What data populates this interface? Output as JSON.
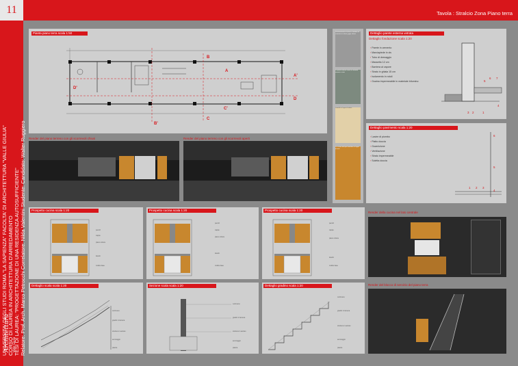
{
  "page_number": "11",
  "header": {
    "title": "Tavola : Stralcio Zona Piano terra"
  },
  "sidebar": {
    "line1": "UNIVERSITA' DEGLI STUDI ROMA \"LA SAPIENZA\" FACOLTA' DI ARCHITETTURA \"VALLE GIULIA\"",
    "line2": "CORSO DI LAUREA IN ARCHITETTURA D'ARREDAMENTO",
    "line3": "TESI DI LAUREA: \"PROGETTAZIONE DI UNA RESIDENZA AUTOSUFFICIENTE\"",
    "line4": "Relatore: Prof. Arch. Marco Petrocchi  Correlatore: Nilda Valentini  Studente: Candidato: Walter Ruggiero"
  },
  "logo": {
    "name": "sapienza-valle-giulia-logo"
  },
  "plan": {
    "caption": "Pianta piano terra   scala 1:50",
    "labels": [
      "A",
      "A'",
      "B",
      "B'",
      "C",
      "C'",
      "D",
      "D'"
    ]
  },
  "materials": {
    "caption": "Dettaglio parete esterna vetrata",
    "samples": [
      "Pavimentazione interna in battuto di cemento in colore grigio chiaro",
      "Le pareti esterne sono in cemento armato a vista",
      "Lamelle in legno di abete",
      "Le cucine del tipo lamellare in legno di teak"
    ]
  },
  "wall_detail": {
    "caption": "Dettaglio fondazione   scala 1:20",
    "items": [
      "Parete in cemento",
      "Marciapiede in cls",
      "Tubo di drenaggio",
      "Massetto 12 cm",
      "Barriera al vapore",
      "Strato in ghiaia 15 cm",
      "Isolamento in rotoli",
      "Guaina impermeabile in materiale bitumino"
    ],
    "numbers": [
      "3",
      "2",
      "1",
      "4",
      "5",
      "6",
      "7"
    ]
  },
  "floor_detail": {
    "caption": "Dettaglio pavimento   scala 1:20",
    "items": [
      "Lastre di piombo",
      "Piatto doccia",
      "Guarnizione",
      "Ventilazione",
      "Strato impermeabile",
      "Soletta doccia"
    ],
    "numbers": [
      "1",
      "2",
      "3",
      "4",
      "5",
      "6"
    ]
  },
  "renders_top": {
    "closed": "Render del piano terreno con gli scorrevoli chiusi",
    "open": "Render del piano terreno con gli scorrevoli aperti"
  },
  "kitchens": [
    {
      "caption": "Prospetto cucina   scala 1:20"
    },
    {
      "caption": "Prospetto cucina   scala 1:20"
    },
    {
      "caption": "Prospetto cucina   scala 1:20"
    }
  ],
  "kitchen_notes": [
    "pensili",
    "cappa",
    "piano cottura",
    "lavello",
    "mobile base"
  ],
  "kitchen_render": "Render della cucina nel lato centrale",
  "stairs": [
    {
      "caption": "Dettaglio scala   scala 1:20"
    },
    {
      "caption": "Sezione scala   scala 1:20"
    },
    {
      "caption": "Dettaglio gradino   scala 1:20"
    }
  ],
  "stair_notes": [
    "corrimano",
    "gradini in lamiera",
    "struttura in acciaio",
    "ancoraggio",
    "piastra"
  ],
  "stair_render": "Render del blocco di servizio del piano terra"
}
